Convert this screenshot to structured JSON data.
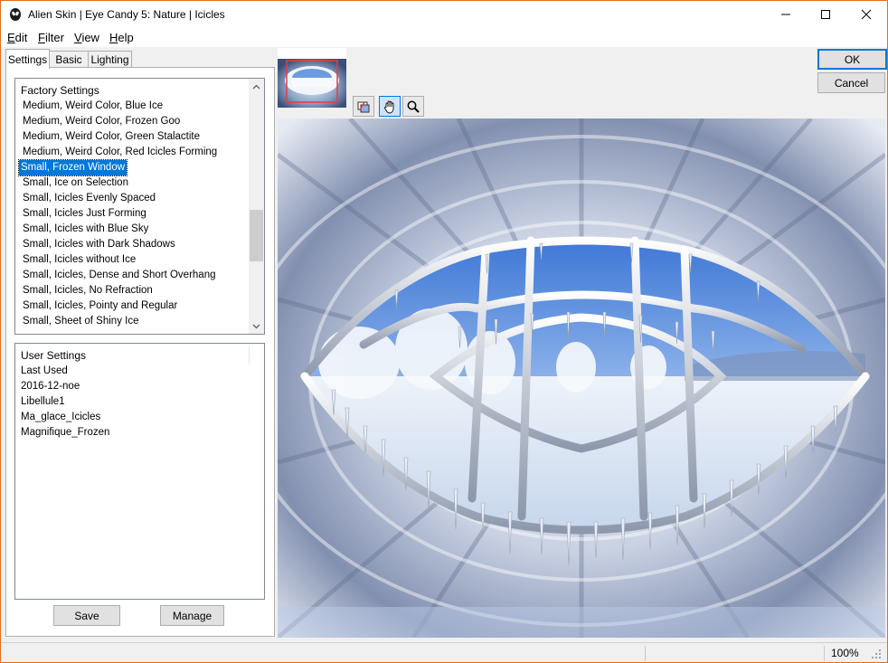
{
  "window": {
    "title": "Alien Skin | Eye Candy 5: Nature | Icicles",
    "controls": {
      "minimize": "—",
      "maximize": "☐",
      "close": "✕"
    }
  },
  "menu": {
    "items": [
      {
        "label": "Edit",
        "key": "E",
        "rest": "dit"
      },
      {
        "label": "Filter",
        "key": "F",
        "rest": "ilter"
      },
      {
        "label": "View",
        "key": "V",
        "rest": "iew"
      },
      {
        "label": "Help",
        "key": "H",
        "rest": "elp"
      }
    ]
  },
  "tabs": [
    "Settings",
    "Basic",
    "Lighting"
  ],
  "factory_settings": {
    "header": "Factory Settings",
    "items": [
      "Medium, Weird Color, Blue Ice",
      "Medium, Weird Color, Frozen Goo",
      "Medium, Weird Color, Green Stalactite",
      "Medium, Weird Color, Red Icicles Forming",
      "Small, Frozen Window",
      "Small, Ice on Selection",
      "Small, Icicles Evenly Spaced",
      "Small, Icicles Just Forming",
      "Small, Icicles with Blue Sky",
      "Small, Icicles with Dark Shadows",
      "Small, Icicles without Ice",
      "Small, Icicles, Dense and Short Overhang",
      "Small, Icicles, No Refraction",
      "Small, Icicles, Pointy and Regular",
      "Small, Sheet of Shiny Ice"
    ],
    "selected_index": 4
  },
  "user_settings": {
    "header": "User Settings",
    "items": [
      "Last Used",
      "2016-12-noe",
      "Libellule1",
      "Ma_glace_Icicles",
      "Magnifique_Frozen"
    ]
  },
  "buttons": {
    "save": "Save",
    "manage": "Manage",
    "ok": "OK",
    "cancel": "Cancel"
  },
  "tools": {
    "navigator": "navigator-icon",
    "hand": "hand-pan-icon",
    "zoom": "magnifier-icon"
  },
  "status": {
    "zoom": "100%"
  },
  "colors": {
    "accent": "#0078d7",
    "window_border": "#e0701c"
  }
}
